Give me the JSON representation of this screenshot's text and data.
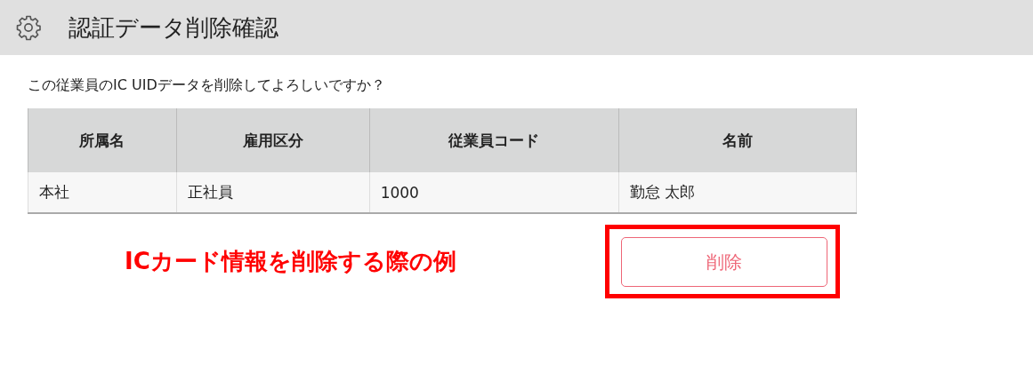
{
  "header": {
    "title": "認証データ削除確認"
  },
  "message": "この従業員のIC UIDデータを削除してよろしいですか？",
  "table": {
    "columns": [
      "所属名",
      "雇用区分",
      "従業員コード",
      "名前"
    ],
    "rows": [
      [
        "本社",
        "正社員",
        "1000",
        "勤怠 太郎"
      ]
    ]
  },
  "annotation": "ICカード情報を削除する際の例",
  "delete_button": "削除"
}
